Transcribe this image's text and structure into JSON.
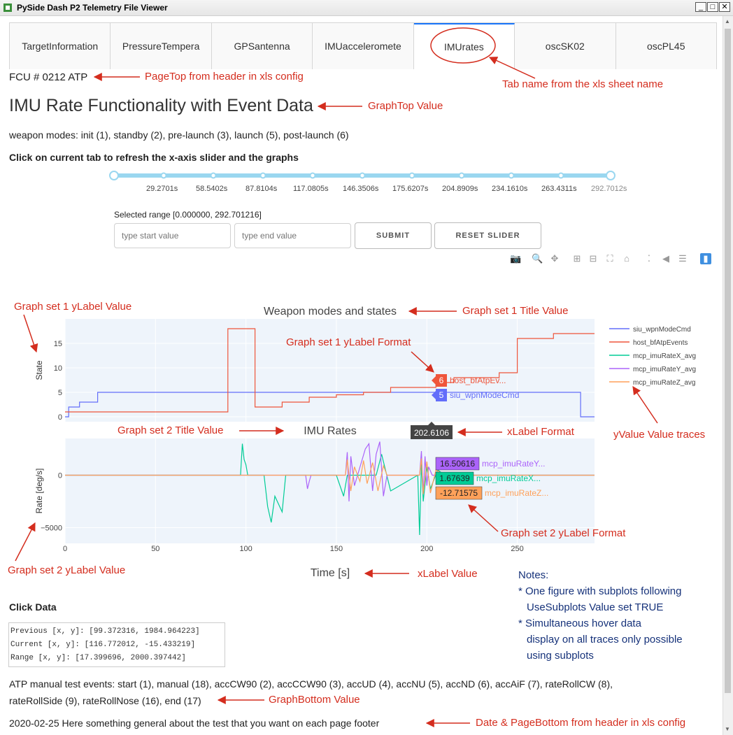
{
  "window": {
    "title": "PySide Dash P2 Telemetry File Viewer",
    "min": "_",
    "max": "□",
    "close": "✕"
  },
  "tabs": [
    {
      "label": "TargetInformation"
    },
    {
      "label": "PressureTempera"
    },
    {
      "label": "GPSantenna"
    },
    {
      "label": "IMUacceleromete"
    },
    {
      "label": "IMUrates"
    },
    {
      "label": "oscSK02"
    },
    {
      "label": "oscPL45"
    }
  ],
  "page": {
    "page_top": "FCU # 0212 ATP",
    "graph_top": "IMU Rate Functionality with Event Data",
    "weapon_modes": "weapon modes: init (1), standby (2), pre-launch (3), launch (5), post-launch (6)",
    "refresh_hint": "Click on current tab to refresh the x-axis slider and the graphs",
    "selected_range": "Selected range [0.000000, 292.701216]",
    "start_placeholder": "type start value",
    "end_placeholder": "type end value",
    "submit_label": "SUBMIT",
    "reset_label": "RESET SLIDER",
    "click_data_title": "Click Data",
    "click_previous": "Previous [x, y]: [99.372316, 1984.964223]",
    "click_current": "Current [x, y]: [116.772012, -15.433219]",
    "click_range": "Range [x, y]: [17.399696, 2000.397442]",
    "graph_bottom_1": "ATP manual test events: start (1), manual (18), accCW90 (2), accCCW90 (3), accUD (4), accNU (5), accND (6), accAiF (7), rateRollCW (8),",
    "graph_bottom_2": "rateRollSide (9), rateRollNose (16), end (17)",
    "footer": "2020-02-25 Here something general about the test that you want on each page footer"
  },
  "slider": {
    "marks": [
      "29.2701s",
      "58.5402s",
      "87.8104s",
      "117.0805s",
      "146.3506s",
      "175.6207s",
      "204.8909s",
      "234.1610s",
      "263.4311s",
      "292.7012s"
    ],
    "range": [
      0,
      292.701216
    ],
    "color": "#9ad7f0"
  },
  "modebar_icons": [
    "camera-icon",
    "zoom-icon",
    "pan-icon",
    "zoom-in-icon",
    "zoom-out-icon",
    "autoscale-icon",
    "reset-axes-icon",
    "spike-lines-icon",
    "hover-closest-icon",
    "hover-compare-icon",
    "plotly-logo-icon"
  ],
  "annotations": {
    "page_top": "PageTop from header in xls config",
    "tab_name": "Tab name from the xls sheet name",
    "graph_top": "GraphTop Value",
    "g1_ylabel": "Graph set 1 yLabel Value",
    "g1_title": "Graph set 1 Title Value",
    "g1_yformat": "Graph set 1 yLabel Format",
    "g2_title": "Graph set 2 Title Value",
    "xlabel_format": "xLabel Format",
    "yvalue_traces": "yValue Value traces",
    "g2_yformat": "Graph set 2 yLabel Format",
    "g2_ylabel": "Graph set 2 yLabel Value",
    "xlabel_value": "xLabel Value",
    "graph_bottom": "GraphBottom Value",
    "date_bottom": "Date & PageBottom from header in xls config",
    "accent": "#d42d1e"
  },
  "notes": {
    "title": "Notes:",
    "line1": "* One figure with subplots following",
    "line2": "UseSubplots Value set TRUE",
    "line3": "* Simultaneous hover data",
    "line4": "display on all traces only possible",
    "line5": "using subplots"
  },
  "chart_data": {
    "type": "line",
    "x_range": [
      0,
      292.7
    ],
    "xlabel": "Time [s]",
    "x_ticks": [
      0,
      50,
      100,
      150,
      200,
      250
    ],
    "hover_x": "202.6106",
    "legend_placement": "right",
    "subplots": [
      {
        "title": "Weapon modes and states",
        "ylabel": "State",
        "ylim": [
          -1,
          20
        ],
        "y_ticks": [
          0,
          5,
          10,
          15
        ],
        "series": [
          {
            "name": "siu_wpnModeCmd",
            "color": "#636efa",
            "x": [
              0,
              2,
              2,
              8,
              8,
              18,
              18,
              285,
              285,
              292.7
            ],
            "y": [
              0,
              0,
              2,
              2,
              3,
              3,
              5,
              5,
              0,
              0
            ],
            "hover_value": "5",
            "hover_label": "siu_wpnModeCmd"
          },
          {
            "name": "host_bfAtpEvents",
            "color": "#ef553b",
            "x": [
              0,
              90,
              90,
              105,
              105,
              120,
              120,
              135,
              135,
              150,
              150,
              165,
              165,
              180,
              180,
              195,
              195,
              205,
              205,
              215,
              215,
              240,
              240,
              250,
              250,
              262,
              262,
              270,
              270,
              292.7
            ],
            "y": [
              1,
              1,
              18,
              18,
              2,
              2,
              3,
              3,
              4,
              4,
              4.5,
              4.5,
              5,
              5,
              6,
              6,
              6,
              6,
              7,
              7,
              8,
              8,
              9,
              9,
              16,
              16,
              16,
              16,
              17,
              17
            ],
            "hover_value": "6",
            "hover_label": "host_bfAtpEv..."
          }
        ]
      },
      {
        "title": "IMU Rates",
        "ylabel": "Rate [deg/s]",
        "ylim": [
          -6500,
          3500
        ],
        "y_ticks": [
          0,
          -5000
        ],
        "series": [
          {
            "name": "mcp_imuRateX_avg",
            "color": "#00cc96",
            "hover_value": "1.67639",
            "hover_label": "mcp_imuRateX...",
            "x": [
              0,
              97,
              98,
              99,
              100,
              101,
              110,
              112,
              114,
              116,
              120,
              122,
              150,
              154,
              156,
              172,
              175,
              180,
              195,
              196,
              197,
              198,
              200,
              202,
              206,
              210,
              220,
              240,
              270,
              292.7
            ],
            "y": [
              0,
              0,
              3000,
              1500,
              1000,
              0,
              0,
              -3000,
              -4500,
              -2000,
              -3500,
              0,
              0,
              -2000,
              0,
              0,
              2000,
              -1500,
              0,
              -5700,
              1200,
              -2500,
              800,
              -1300,
              500,
              0,
              0,
              0,
              0,
              0
            ]
          },
          {
            "name": "mcp_imuRateY_avg",
            "color": "#ab63fa",
            "hover_value": "16.50616",
            "hover_label": "mcp_imuRateY...",
            "x": [
              0,
              133,
              134,
              135,
              136,
              155,
              156,
              157,
              158,
              160,
              166,
              168,
              170,
              172,
              174,
              176,
              178,
              196,
              197,
              198,
              199,
              200,
              201,
              203,
              210,
              292.7
            ],
            "y": [
              0,
              0,
              -1300,
              -600,
              0,
              0,
              2200,
              -2500,
              1800,
              -1000,
              2500,
              3000,
              -1500,
              2000,
              3200,
              -2000,
              0,
              0,
              2300,
              -1800,
              1800,
              -1000,
              800,
              0,
              0,
              0
            ]
          },
          {
            "name": "mcp_imuRateZ_avg",
            "color": "#ffa15a",
            "hover_value": "-12.71575",
            "hover_label": "mcp_imuRateZ...",
            "x": [
              0,
              155,
              156,
              158,
              160,
              163,
              165,
              167,
              170,
              173,
              176,
              178,
              196,
              197,
              198,
              200,
              202,
              205,
              210,
              292.7
            ],
            "y": [
              0,
              0,
              1500,
              -1500,
              800,
              -600,
              1400,
              -800,
              1200,
              -1500,
              900,
              0,
              0,
              1600,
              -1800,
              1300,
              -1700,
              500,
              0,
              0
            ]
          }
        ]
      }
    ]
  }
}
